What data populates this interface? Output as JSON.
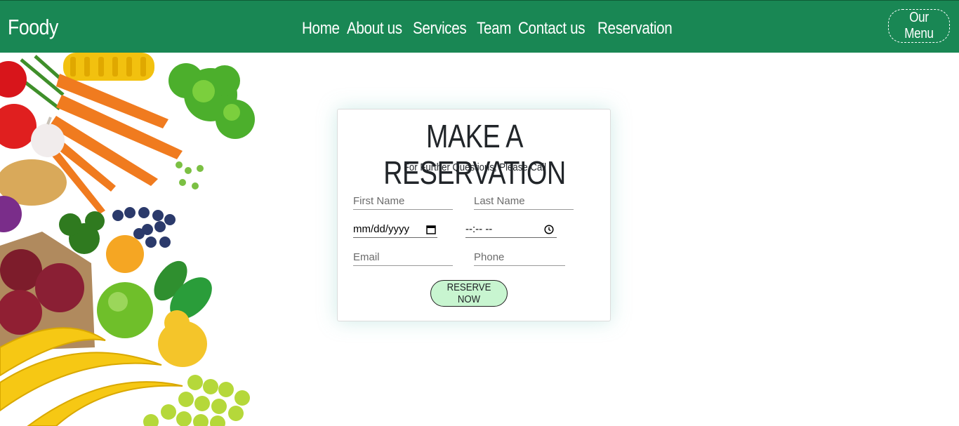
{
  "header": {
    "brand": "Foody",
    "nav": [
      "Home",
      "About us",
      "Services",
      "Team",
      "Contact us",
      "Reservation"
    ],
    "menu_button": "Our Menu",
    "bg_color": "#198754"
  },
  "reservation": {
    "title": "MAKE A RESERVATION",
    "subtitle": "For Further Questions, Please Call",
    "first_name_placeholder": "First Name",
    "last_name_placeholder": "Last Name",
    "date_value": "mm/dd/yyyy",
    "time_value": "--:-- --",
    "email_placeholder": "Email",
    "phone_placeholder": "Phone",
    "submit_label": "RESERVE NOW",
    "submit_color": "#c8f5d0"
  },
  "icons": {
    "date": "calendar-icon",
    "time": "clock-icon"
  }
}
